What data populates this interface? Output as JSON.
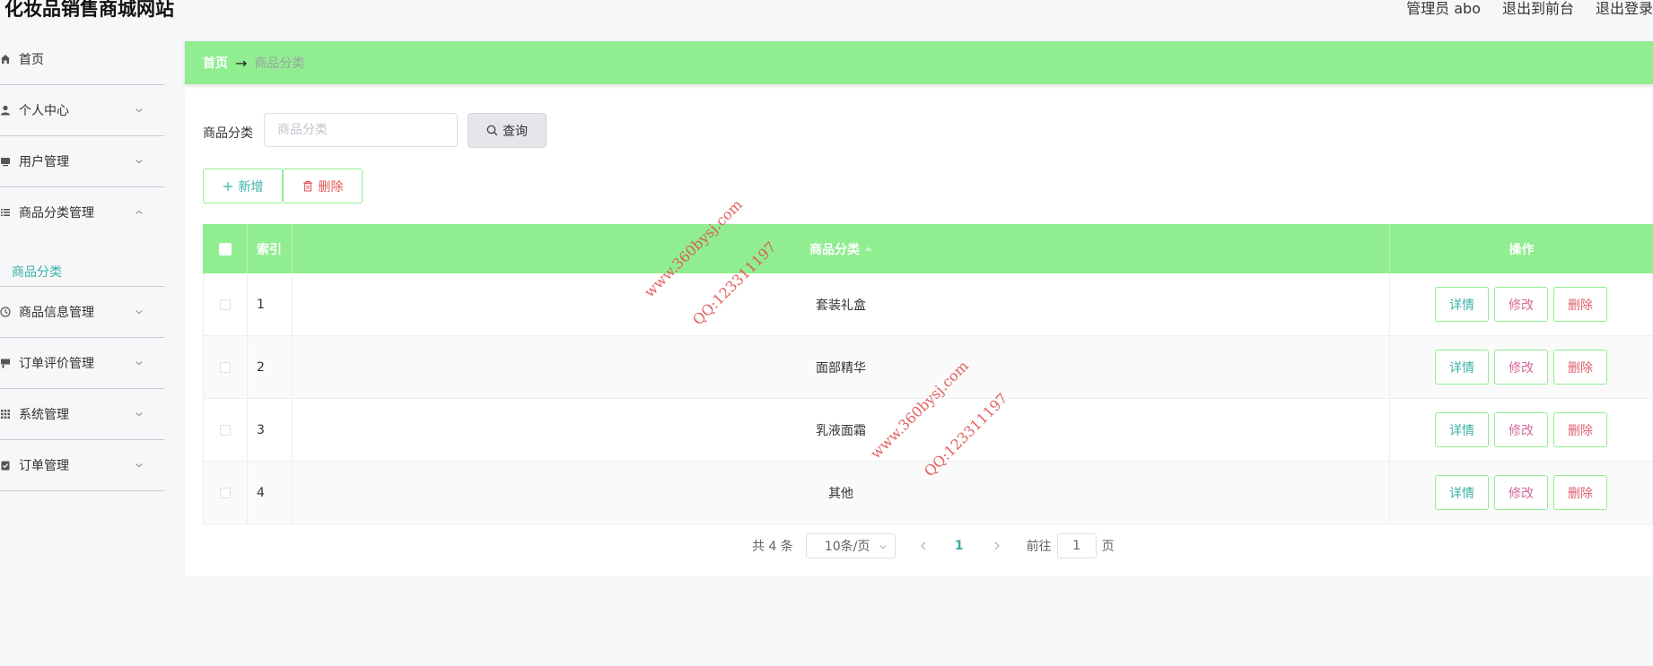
{
  "header": {
    "site_title": "化妆品销售商城网站",
    "admin": "管理员 abo",
    "exit_front": "退出到前台",
    "logout": "退出登录"
  },
  "sidebar": {
    "items": [
      {
        "label": "首页",
        "icon": "home-icon"
      },
      {
        "label": "个人中心",
        "icon": "user-icon"
      },
      {
        "label": "用户管理",
        "icon": "card-icon"
      },
      {
        "label": "商品分类管理",
        "icon": "list-icon",
        "expanded": true,
        "sub": [
          "商品分类"
        ]
      },
      {
        "label": "商品信息管理",
        "icon": "clock-icon"
      },
      {
        "label": "订单评价管理",
        "icon": "comment-icon"
      },
      {
        "label": "系统管理",
        "icon": "grid-icon"
      },
      {
        "label": "订单管理",
        "icon": "clipboard-check-icon"
      }
    ]
  },
  "breadcrumb": {
    "home": "首页",
    "arrow": "→",
    "current": "商品分类"
  },
  "search": {
    "label": "商品分类",
    "placeholder": "商品分类",
    "button": "查询"
  },
  "actions": {
    "add": "新增",
    "delete": "删除"
  },
  "table": {
    "headers": {
      "index": "索引",
      "category": "商品分类",
      "ops": "操作"
    },
    "rows": [
      {
        "index": "1",
        "category": "套装礼盒"
      },
      {
        "index": "2",
        "category": "面部精华"
      },
      {
        "index": "3",
        "category": "乳液面霜"
      },
      {
        "index": "4",
        "category": "其他"
      }
    ],
    "op_labels": {
      "detail": "详情",
      "edit": "修改",
      "delete": "删除"
    }
  },
  "pagination": {
    "total": "共 4 条",
    "page_size": "10条/页",
    "current_page": "1",
    "goto_label": "前往",
    "goto_value": "1",
    "page_suffix": "页"
  },
  "watermarks": {
    "site": "www.360bysj.com",
    "qq": "QQ:123311197"
  },
  "colors": {
    "accent_green": "#90ee90",
    "teal_text": "#3bb0a6",
    "danger_text": "#e05a5a"
  }
}
